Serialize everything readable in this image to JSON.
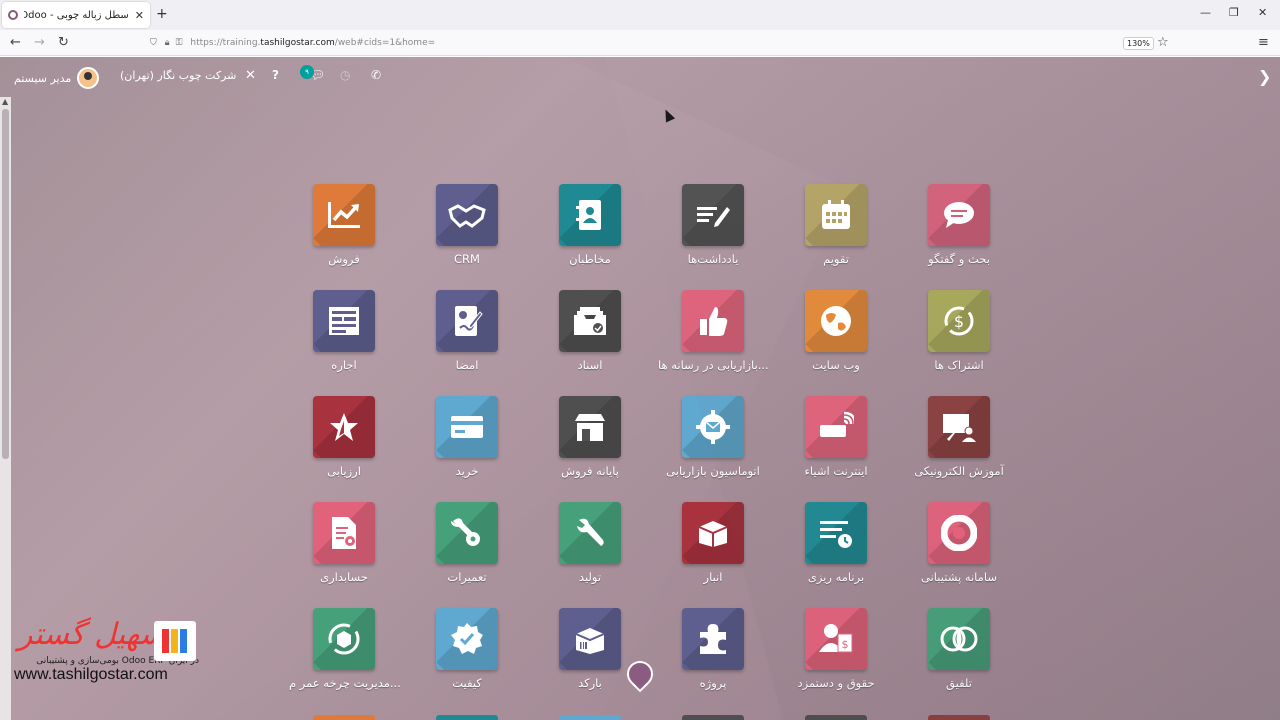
{
  "browser": {
    "tab_title": "سطل زباله چوبی - Odoo",
    "tab_close": "✕",
    "new_tab": "+",
    "url_prefix": "https://training.",
    "url_domain": "tashilgostar.com",
    "url_suffix": "/web#cids=1&home=",
    "zoom": "130%"
  },
  "topbar": {
    "user_name": "مدیر سیستم",
    "company": "شرکت چوب نگار (تهران)",
    "chat_badge": "۹"
  },
  "apps": [
    {
      "label": "بحث و گفتگو",
      "color": "#d45f7a",
      "icon": "chat-icon"
    },
    {
      "label": "تقویم",
      "color": "#b5a365",
      "icon": "calendar-icon"
    },
    {
      "label": "یادداشت‌ها",
      "color": "#4f4f50",
      "icon": "notes-icon"
    },
    {
      "label": "مخاطبان",
      "color": "#1f8a94",
      "icon": "contacts-icon"
    },
    {
      "label": "CRM",
      "color": "#5e5f8f",
      "icon": "handshake-icon"
    },
    {
      "label": "فروش",
      "color": "#e07a3a",
      "icon": "chart-line-icon"
    },
    {
      "label": "اشتراک ها",
      "color": "#a8a85a",
      "icon": "subscription-icon"
    },
    {
      "label": "وب سایت",
      "color": "#e58a38",
      "icon": "globe-icon"
    },
    {
      "label": "بازاریابی در رسانه ها...",
      "color": "#e2627c",
      "icon": "thumbs-up-icon"
    },
    {
      "label": "اسناد",
      "color": "#4f4f50",
      "icon": "documents-icon"
    },
    {
      "label": "امضا",
      "color": "#5e5f8f",
      "icon": "sign-icon"
    },
    {
      "label": "اجاره",
      "color": "#5e5f8f",
      "icon": "rental-icon"
    },
    {
      "label": "آموزش الکترونیکی",
      "color": "#8b3f3f",
      "icon": "elearning-icon"
    },
    {
      "label": "اینترنت اشیاء",
      "color": "#e2627c",
      "icon": "iot-icon"
    },
    {
      "label": "اتوماسیون بازاریابی",
      "color": "#5fa8cf",
      "icon": "gear-mail-icon"
    },
    {
      "label": "پایانه فروش",
      "color": "#4f4f50",
      "icon": "store-icon"
    },
    {
      "label": "خرید",
      "color": "#5fa8cf",
      "icon": "credit-card-icon"
    },
    {
      "label": "ارزیابی",
      "color": "#a8323e",
      "icon": "star-icon"
    },
    {
      "label": "سامانه پشتیبانی",
      "color": "#e2627c",
      "icon": "lifebuoy-icon"
    },
    {
      "label": "برنامه ریزی",
      "color": "#1f8a94",
      "icon": "planning-icon"
    },
    {
      "label": "انبار",
      "color": "#a8323e",
      "icon": "box-icon"
    },
    {
      "label": "تولید",
      "color": "#46a07a",
      "icon": "wrench-icon"
    },
    {
      "label": "تعمیرات",
      "color": "#46a07a",
      "icon": "tools-icon"
    },
    {
      "label": "حسابداری",
      "color": "#e2627c",
      "icon": "accounting-icon"
    },
    {
      "label": "تلفیق",
      "color": "#46a07a",
      "icon": "consolidation-icon"
    },
    {
      "label": "حقوق و دستمزد",
      "color": "#e2627c",
      "icon": "payroll-icon"
    },
    {
      "label": "پروژه",
      "color": "#5e5f8f",
      "icon": "puzzle-icon"
    },
    {
      "label": "بارکد",
      "color": "#5e5f8f",
      "icon": "barcode-box-icon"
    },
    {
      "label": "کیفیت",
      "color": "#5fa8cf",
      "icon": "quality-icon"
    },
    {
      "label": "مدیریت چرخه عمر م...",
      "color": "#46a07a",
      "icon": "plm-icon"
    }
  ],
  "watermark": {
    "logo_text": "تسهیل گستر",
    "subtitle": "بومی‌سازی و پشتیبانی Odoo ERP در ایران",
    "site": "www.tashilgostar.com"
  }
}
